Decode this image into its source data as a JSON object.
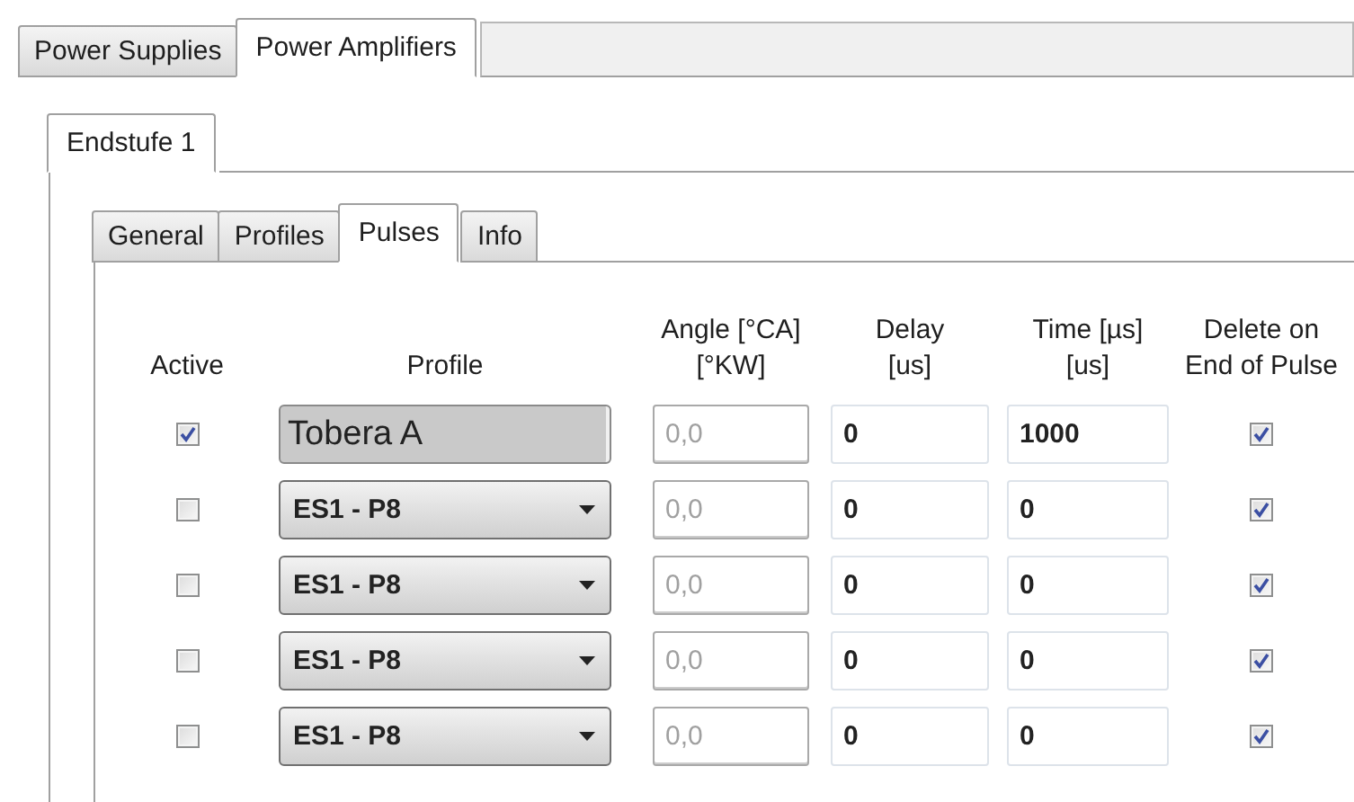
{
  "top_tabs": [
    {
      "label": "Power Supplies",
      "selected": false
    },
    {
      "label": "Power Amplifiers",
      "selected": true
    }
  ],
  "amplifier_tabs": [
    {
      "label": "Endstufe 1",
      "selected": true
    }
  ],
  "sub_tabs": [
    {
      "label": "General",
      "selected": false
    },
    {
      "label": "Profiles",
      "selected": false
    },
    {
      "label": "Pulses",
      "selected": true
    },
    {
      "label": "Info",
      "selected": false
    }
  ],
  "columns": [
    {
      "lines": [
        "Active"
      ]
    },
    {
      "lines": [
        "Profile"
      ]
    },
    {
      "lines": [
        "Angle [°CA]",
        "[°KW]"
      ]
    },
    {
      "lines": [
        "Delay",
        "[us]"
      ]
    },
    {
      "lines": [
        "Time [µs]",
        "[us]"
      ]
    },
    {
      "lines": [
        "Delete on",
        "End of Pulse"
      ]
    }
  ],
  "pulses": [
    {
      "active": true,
      "profile": {
        "kind": "button",
        "text": "Tobera A"
      },
      "angle": {
        "value": "0,0",
        "disabled": true
      },
      "delay": "0",
      "time": "1000",
      "delete_on_end": true
    },
    {
      "active": false,
      "profile": {
        "kind": "dropdown",
        "text": "ES1 - P8"
      },
      "angle": {
        "value": "0,0",
        "disabled": true
      },
      "delay": "0",
      "time": "0",
      "delete_on_end": true
    },
    {
      "active": false,
      "profile": {
        "kind": "dropdown",
        "text": "ES1 - P8"
      },
      "angle": {
        "value": "0,0",
        "disabled": true
      },
      "delay": "0",
      "time": "0",
      "delete_on_end": true
    },
    {
      "active": false,
      "profile": {
        "kind": "dropdown",
        "text": "ES1 - P8"
      },
      "angle": {
        "value": "0,0",
        "disabled": true
      },
      "delay": "0",
      "time": "0",
      "delete_on_end": true
    },
    {
      "active": false,
      "profile": {
        "kind": "dropdown",
        "text": "ES1 - P8"
      },
      "angle": {
        "value": "0,0",
        "disabled": true
      },
      "delay": "0",
      "time": "0",
      "delete_on_end": true
    }
  ]
}
